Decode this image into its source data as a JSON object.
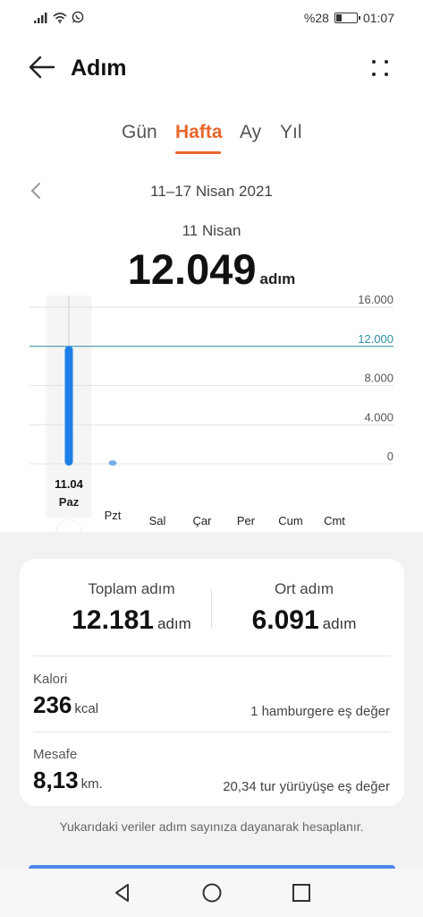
{
  "status_bar": {
    "battery_text": "%28",
    "battery_level_fraction": 0.28,
    "time": "01:07",
    "icons": [
      "signal-icon",
      "wifi-icon",
      "whatsapp-icon",
      "battery-icon"
    ]
  },
  "header": {
    "title": "Adım",
    "back_icon": "arrow-left-icon",
    "more_icon": "more-dots-icon"
  },
  "tabs": [
    {
      "label": "Gün",
      "active": false
    },
    {
      "label": "Hafta",
      "active": true
    },
    {
      "label": "Ay",
      "active": false
    },
    {
      "label": "Yıl",
      "active": false
    }
  ],
  "range": {
    "label": "11–17 Nisan 2021",
    "prev_icon": "chevron-left-icon"
  },
  "selection": {
    "date": "11 Nisan",
    "value": "12.049",
    "unit": "adım"
  },
  "chart_data": {
    "type": "bar",
    "categories": [
      "Paz",
      "Pzt",
      "Sal",
      "Çar",
      "Per",
      "Cum",
      "Cmt"
    ],
    "values": [
      12049,
      132,
      0,
      0,
      0,
      0,
      0
    ],
    "ylim": [
      0,
      16000
    ],
    "yticks": [
      "16.000",
      "12.000",
      "8.000",
      "4.000",
      "0"
    ],
    "ytick_values": [
      16000,
      12000,
      8000,
      4000,
      0
    ],
    "goal_line_value": 12000,
    "goal_label": "12.000",
    "selected_index": 0,
    "selected_date_label": "11.04",
    "grid": true,
    "axis_position": "right",
    "colors": {
      "bar": "#1f7fe8",
      "bar_light": "#78aee8",
      "goal": "#2e8fa5",
      "grid": "#e3e3e3"
    }
  },
  "summary": {
    "total_label": "Toplam adım",
    "total_value": "12.181",
    "total_unit": "adım",
    "avg_label": "Ort adım",
    "avg_value": "6.091",
    "avg_unit": "adım",
    "calories_label": "Kalori",
    "calories_value": "236",
    "calories_unit": "kcal",
    "calories_note": "1 hamburgere eş değer",
    "distance_label": "Mesafe",
    "distance_value": "8,13",
    "distance_unit": "km.",
    "distance_note": "20,34 tur yürüyüşe eş değer"
  },
  "footnote": "Yukarıdaki veriler adım sayınıza dayanarak hesaplanır.",
  "navbar": {
    "icons": [
      "nav-back-icon",
      "nav-home-icon",
      "nav-recents-icon"
    ]
  },
  "colors": {
    "accent": "#e8662c",
    "chart_blue": "#1f7fe8",
    "background": "#f2f2f2",
    "card": "#ffffff"
  }
}
